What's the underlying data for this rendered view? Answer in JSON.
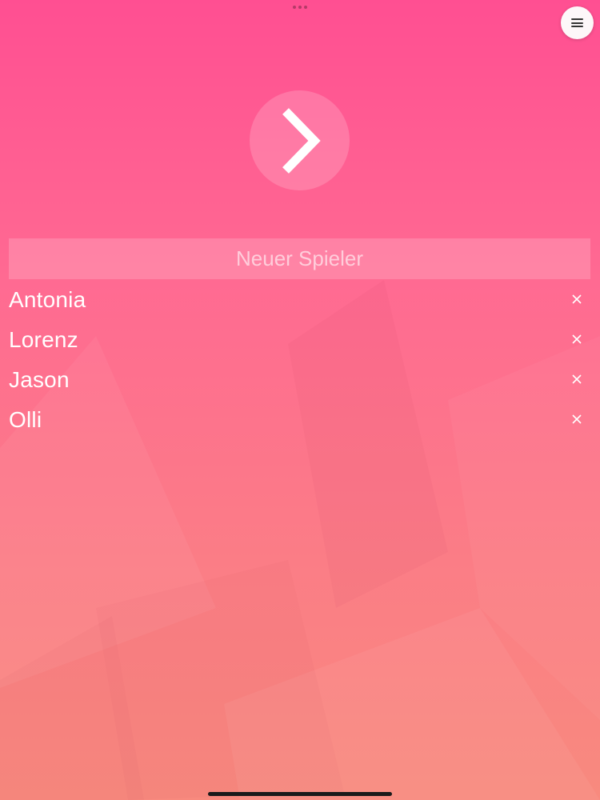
{
  "colors": {
    "background_top": "#ff4f92",
    "background_bottom": "#f88a7e",
    "text": "#ffffff"
  },
  "top_bar": {
    "multitasking_icon": "ellipsis-icon",
    "menu_icon": "hamburger-menu-icon"
  },
  "next_button": {
    "icon": "chevron-right-icon"
  },
  "new_player": {
    "placeholder": "Neuer Spieler",
    "value": ""
  },
  "players": [
    {
      "name": "Antonia",
      "remove_icon": "close-icon"
    },
    {
      "name": "Lorenz",
      "remove_icon": "close-icon"
    },
    {
      "name": "Jason",
      "remove_icon": "close-icon"
    },
    {
      "name": "Olli",
      "remove_icon": "close-icon"
    }
  ]
}
